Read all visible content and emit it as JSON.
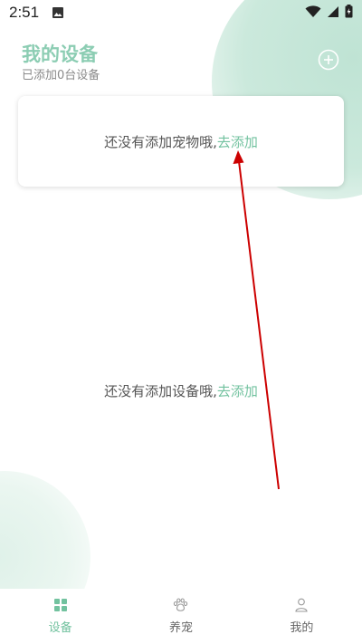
{
  "status_bar": {
    "time": "2:51"
  },
  "header": {
    "title": "我的设备",
    "subtitle": "已添加0台设备"
  },
  "pet_card": {
    "message": "还没有添加宠物哦,",
    "link": "去添加"
  },
  "device_empty": {
    "message": "还没有添加设备哦,",
    "link": "去添加"
  },
  "bottom_nav": {
    "items": [
      {
        "label": "设备",
        "icon": "grid-icon",
        "active": true
      },
      {
        "label": "养宠",
        "icon": "paw-icon",
        "active": false
      },
      {
        "label": "我的",
        "icon": "person-icon",
        "active": false
      }
    ]
  },
  "colors": {
    "accent": "#72c29f",
    "title": "#8ccdb3",
    "annotation_arrow": "#cc0000"
  }
}
